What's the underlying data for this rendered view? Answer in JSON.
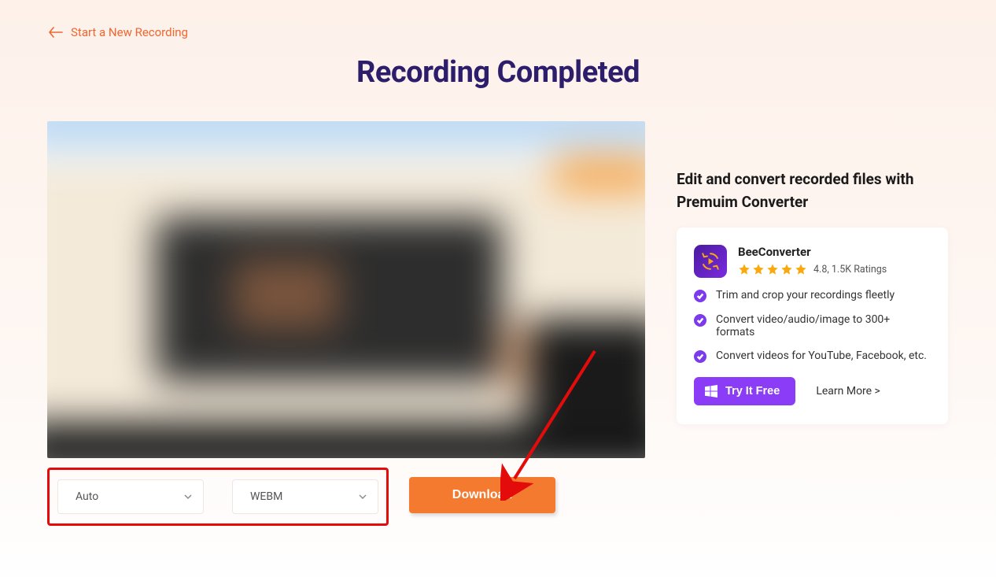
{
  "nav": {
    "back_label": "Start a New Recording"
  },
  "page": {
    "title": "Recording Completed"
  },
  "preview": {
    "quality_select": "Auto",
    "format_select": "WEBM",
    "download_label": "Download"
  },
  "promo": {
    "heading": "Edit and convert recorded files with Premuim Converter",
    "app_name": "BeeConverter",
    "rating_text": "4.8, 1.5K Ratings",
    "features": [
      "Trim and crop your recordings fleetly",
      "Convert video/audio/image to 300+ formats",
      "Convert videos for YouTube, Facebook, etc."
    ],
    "try_label": "Try It Free",
    "learn_label": "Learn More >"
  },
  "colors": {
    "accent_orange": "#f47a2f",
    "accent_purple": "#8b3cf6",
    "title_navy": "#2d1e6b",
    "highlight_red": "#e40b0b",
    "star_gold": "#f9a90e"
  }
}
